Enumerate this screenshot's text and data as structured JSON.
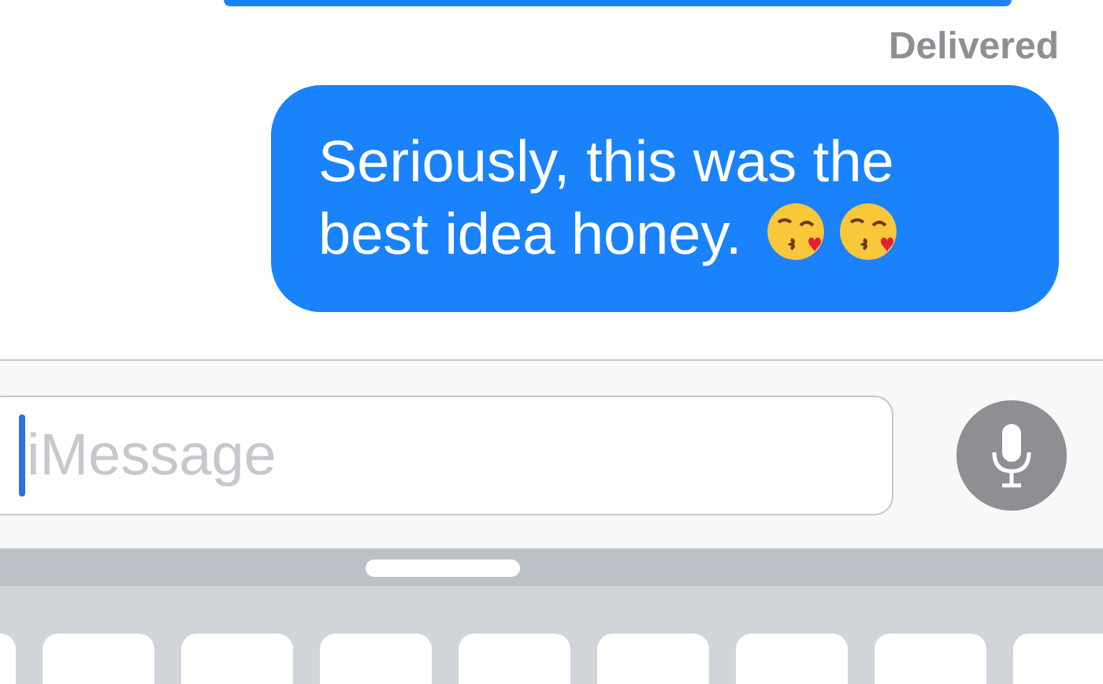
{
  "messages": [
    {
      "kind": "cut"
    }
  ],
  "status": "Delivered",
  "bubble": {
    "text": "Seriously, this was the best idea honey."
  },
  "input": {
    "placeholder": "iMessage"
  }
}
